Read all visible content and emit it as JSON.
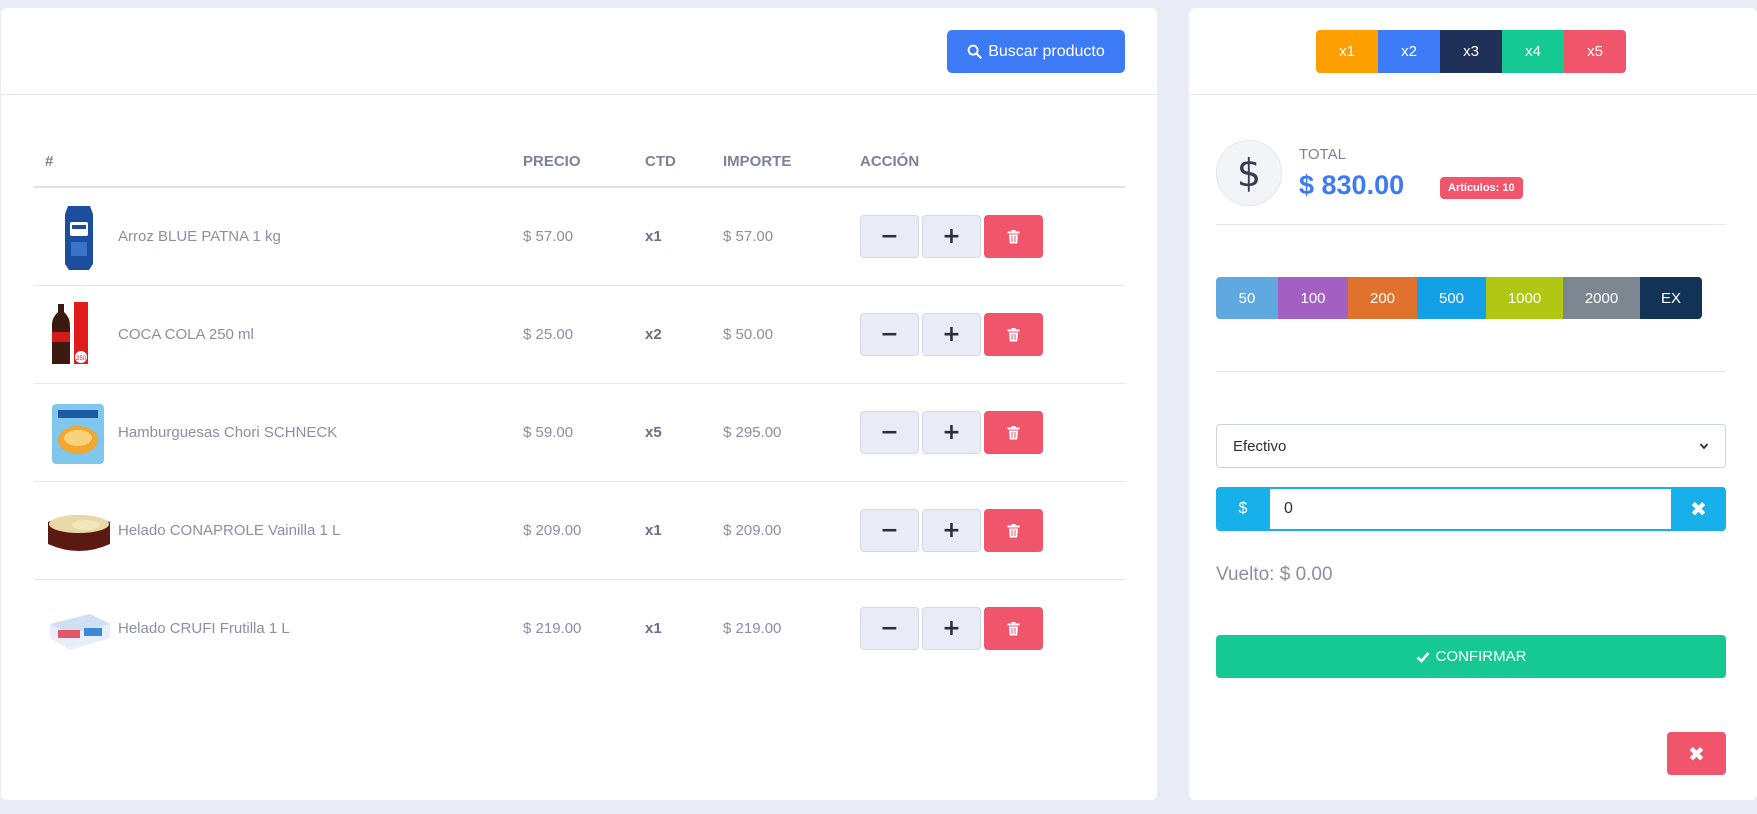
{
  "search": {
    "label": "Buscar producto"
  },
  "table": {
    "headers": {
      "num": "#",
      "price": "PRECIO",
      "qty": "CTD",
      "amount": "IMPORTE",
      "action": "ACCIÓN"
    },
    "rows": [
      {
        "name": "Arroz BLUE PATNA 1 kg",
        "price": "$ 57.00",
        "qty": "x1",
        "amount": "$ 57.00",
        "thumb": "rice-bag"
      },
      {
        "name": "COCA COLA 250 ml",
        "price": "$ 25.00",
        "qty": "x2",
        "amount": "$ 50.00",
        "thumb": "cola-bottle"
      },
      {
        "name": "Hamburguesas Chori SCHNECK",
        "price": "$ 59.00",
        "qty": "x5",
        "amount": "$ 295.00",
        "thumb": "burger-pack"
      },
      {
        "name": "Helado CONAPROLE Vainilla 1 L",
        "price": "$ 209.00",
        "qty": "x1",
        "amount": "$ 209.00",
        "thumb": "icecream-tub"
      },
      {
        "name": "Helado CRUFI Frutilla 1 L",
        "price": "$ 219.00",
        "qty": "x1",
        "amount": "$ 219.00",
        "thumb": "icecream-box"
      }
    ],
    "minus": "−",
    "plus": "+"
  },
  "multipliers": [
    {
      "label": "x1",
      "color": "#fd9f01"
    },
    {
      "label": "x2",
      "color": "#3d7af5"
    },
    {
      "label": "x3",
      "color": "#1f3158"
    },
    {
      "label": "x4",
      "color": "#16c993"
    },
    {
      "label": "x5",
      "color": "#f1556c"
    }
  ],
  "total": {
    "label": "TOTAL",
    "value": "$ 830.00",
    "items_badge": "Artículos: 10",
    "icon": "$"
  },
  "denominations": [
    {
      "label": "50",
      "color": "#5fa8e0"
    },
    {
      "label": "100",
      "color": "#a35fc1"
    },
    {
      "label": "200",
      "color": "#e0722d"
    },
    {
      "label": "500",
      "color": "#14a0e6"
    },
    {
      "label": "1000",
      "color": "#b0c814"
    },
    {
      "label": "2000",
      "color": "#7c8792"
    },
    {
      "label": "EX",
      "color": "#123355"
    }
  ],
  "payment": {
    "method": "Efectivo",
    "prefix": "$",
    "cash_value": "0",
    "clear": "✖",
    "change": "Vuelto: $ 0.00",
    "confirm": "CONFIRMAR",
    "close": "✖"
  }
}
